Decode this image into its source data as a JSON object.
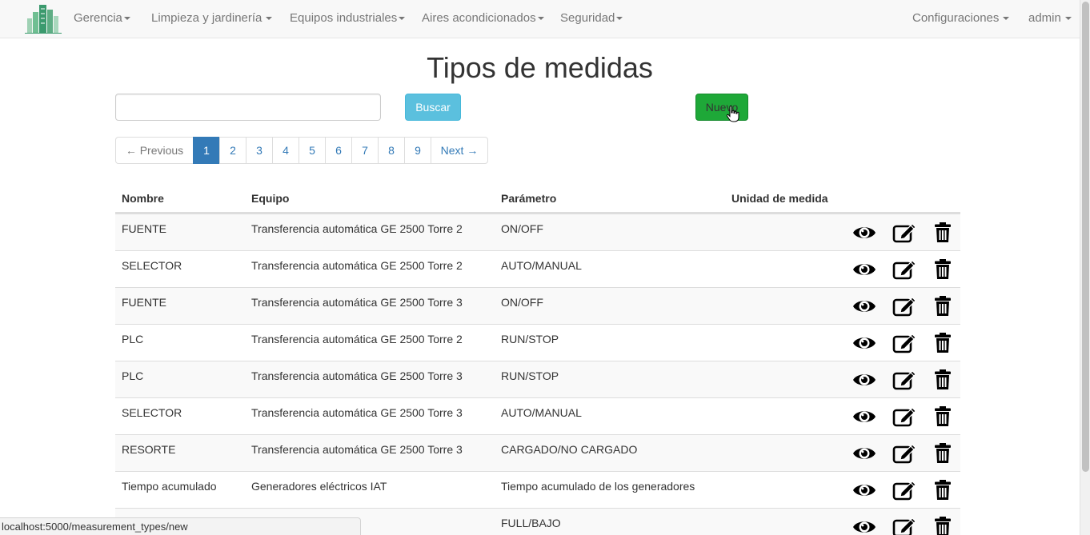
{
  "navbar": {
    "menus": [
      {
        "label": "Gerencia"
      },
      {
        "label": "Limpieza y jardinería"
      },
      {
        "label": "Equipos industriales"
      },
      {
        "label": "Aires acondicionados"
      },
      {
        "label": "Seguridad"
      }
    ],
    "right": [
      {
        "label": "Configuraciones"
      },
      {
        "label": "admin"
      }
    ]
  },
  "page": {
    "title": "Tipos de medidas"
  },
  "search": {
    "value": "",
    "button_label": "Buscar"
  },
  "new_button_label": "Nuevo",
  "pagination": {
    "previous": "← Previous",
    "next": "Next →",
    "pages": [
      "1",
      "2",
      "3",
      "4",
      "5",
      "6",
      "7",
      "8",
      "9"
    ],
    "active_page": "1"
  },
  "table": {
    "columns": [
      "Nombre",
      "Equipo",
      "Parámetro",
      "Unidad de medida"
    ],
    "rows": [
      {
        "nombre": "FUENTE",
        "equipo": "Transferencia automática GE 2500 Torre 2",
        "parametro": "ON/OFF",
        "unidad": ""
      },
      {
        "nombre": "SELECTOR",
        "equipo": "Transferencia automática GE 2500 Torre 2",
        "parametro": "AUTO/MANUAL",
        "unidad": ""
      },
      {
        "nombre": "FUENTE",
        "equipo": "Transferencia automática GE 2500 Torre 3",
        "parametro": "ON/OFF",
        "unidad": ""
      },
      {
        "nombre": "PLC",
        "equipo": "Transferencia automática GE 2500 Torre 2",
        "parametro": "RUN/STOP",
        "unidad": ""
      },
      {
        "nombre": "PLC",
        "equipo": "Transferencia automática GE 2500 Torre 3",
        "parametro": "RUN/STOP",
        "unidad": ""
      },
      {
        "nombre": "SELECTOR",
        "equipo": "Transferencia automática GE 2500 Torre 3",
        "parametro": "AUTO/MANUAL",
        "unidad": ""
      },
      {
        "nombre": "RESORTE",
        "equipo": "Transferencia automática GE 2500 Torre 3",
        "parametro": "CARGADO/NO CARGADO",
        "unidad": ""
      },
      {
        "nombre": "Tiempo acumulado",
        "equipo": "Generadores eléctricos IAT",
        "parametro": "Tiempo acumulado de los generadores",
        "unidad": ""
      },
      {
        "nombre": "",
        "equipo": "os IAT",
        "parametro": "FULL/BAJO",
        "unidad": ""
      }
    ]
  },
  "status_bar": {
    "url": "localhost:5000/measurement_types/new"
  },
  "colors": {
    "primary": "#337ab7",
    "info": "#5bc0de",
    "success": "#1ea838",
    "brand": "#3b9a6e"
  },
  "icons": {
    "brand": "building-logo",
    "view": "eye-icon",
    "edit": "edit-icon",
    "delete": "trash-icon"
  }
}
